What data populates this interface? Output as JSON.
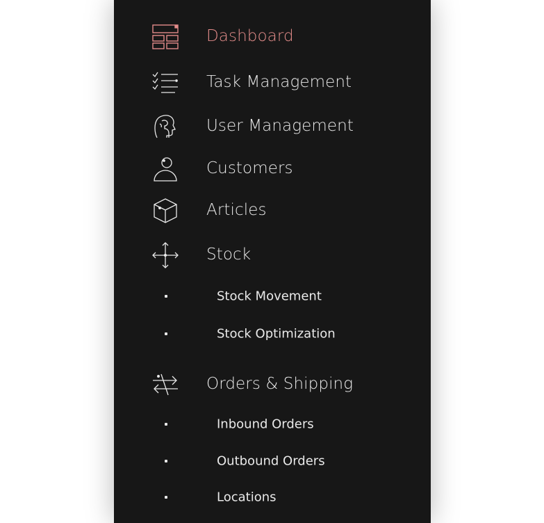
{
  "colors": {
    "sidebar_bg": "#171717",
    "text": "#e9e9e9",
    "active_accent": "#e38c8a",
    "page_bg": "#ffffff"
  },
  "nav": {
    "items": [
      {
        "label": "Dashboard",
        "icon": "dashboard-icon",
        "active": true
      },
      {
        "label": "Task Management",
        "icon": "task-list-icon",
        "active": false
      },
      {
        "label": "User Management",
        "icon": "head-profile-icon",
        "active": false
      },
      {
        "label": "Customers",
        "icon": "person-icon",
        "active": false
      },
      {
        "label": "Articles",
        "icon": "box-icon",
        "active": false
      },
      {
        "label": "Stock",
        "icon": "move-arrows-icon",
        "active": false,
        "children": [
          {
            "label": "Stock Movement"
          },
          {
            "label": "Stock Optimization"
          }
        ]
      },
      {
        "label": "Orders & Shipping",
        "icon": "exchange-arrows-icon",
        "active": false,
        "children": [
          {
            "label": "Inbound Orders"
          },
          {
            "label": "Outbound Orders"
          },
          {
            "label": "Locations"
          }
        ]
      }
    ]
  }
}
